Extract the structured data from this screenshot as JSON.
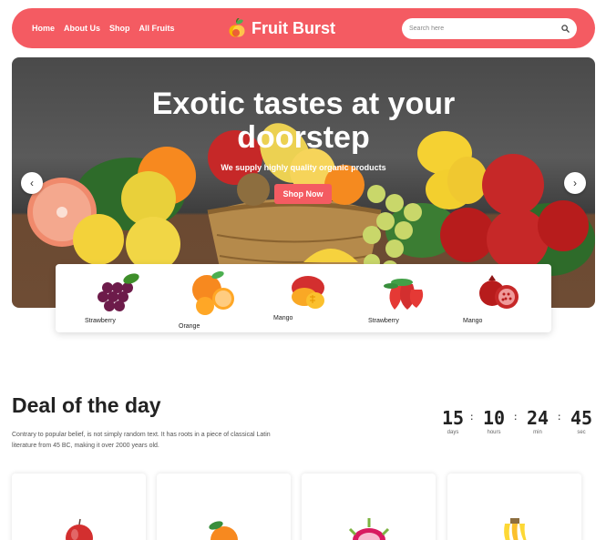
{
  "nav": {
    "links": [
      "Home",
      "About Us",
      "Shop",
      "All Fruits"
    ],
    "brand": "Fruit Burst",
    "search_placeholder": "Search here"
  },
  "hero": {
    "title": "Exotic tastes at your doorstep",
    "subtitle": "We supply highly quality organic products",
    "cta": "Shop Now"
  },
  "categories": [
    {
      "label": "Strawberry",
      "icon": "grapes-icon"
    },
    {
      "label": "Orange",
      "icon": "orange-icon"
    },
    {
      "label": "Mango",
      "icon": "mango-icon"
    },
    {
      "label": "Strawberry",
      "icon": "strawberry-icon"
    },
    {
      "label": "Mango",
      "icon": "pomegranate-icon"
    }
  ],
  "deal": {
    "title": "Deal of the day",
    "description": "Contrary to popular belief, is not simply random text. It has roots in a piece of classical Latin literature from 45 BC, making it over 2000 years old.",
    "countdown": [
      {
        "value": "15",
        "label": "days"
      },
      {
        "value": "10",
        "label": "hours"
      },
      {
        "value": "24",
        "label": "min"
      },
      {
        "value": "45",
        "label": "sec"
      }
    ]
  },
  "products": [
    {
      "icon": "apple-icon"
    },
    {
      "icon": "orange-icon"
    },
    {
      "icon": "dragonfruit-icon"
    },
    {
      "icon": "banana-icon"
    }
  ],
  "colors": {
    "brand": "#f45b62",
    "text": "#222222"
  }
}
